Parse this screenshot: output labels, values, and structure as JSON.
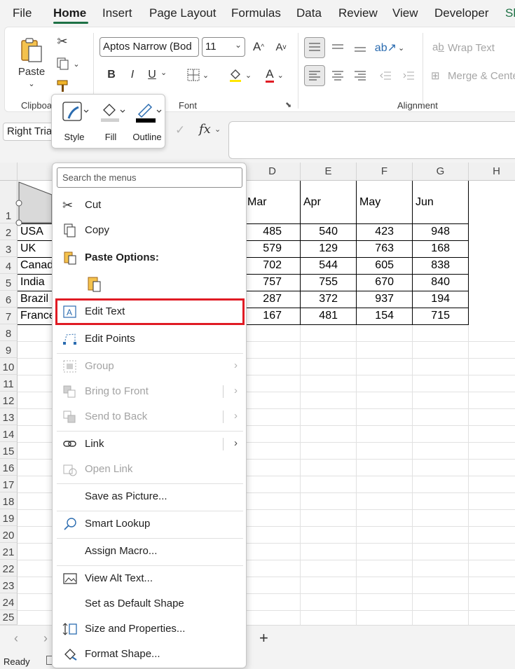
{
  "tabs": [
    "File",
    "Home",
    "Insert",
    "Page Layout",
    "Formulas",
    "Data",
    "Review",
    "View",
    "Developer",
    "Sh"
  ],
  "ribbon": {
    "paste_label": "Paste",
    "clipboard_group": "Clipboa",
    "font_name": "Aptos Narrow (Bod",
    "font_size": "11",
    "font_group": "Font",
    "alignment_group": "Alignment",
    "wrap_text": "Wrap Text",
    "merge_center": "Merge & Cente",
    "bold": "B",
    "italic": "I",
    "underline": "U",
    "font_color_letter": "A",
    "grow_font": "A",
    "shrink_font": "A"
  },
  "formula_bar": {
    "name_box": "Right Tria",
    "fx": "fx"
  },
  "mini_toolbar": {
    "style": "Style",
    "fill": "Fill",
    "outline": "Outline"
  },
  "columns": [
    "D",
    "E",
    "F",
    "G",
    "H"
  ],
  "rows": [
    "1",
    "2",
    "3",
    "4",
    "5",
    "6",
    "7",
    "8",
    "9",
    "10",
    "11",
    "12",
    "13",
    "14",
    "15",
    "16",
    "17",
    "18",
    "19",
    "20",
    "21",
    "22",
    "23",
    "24",
    "25"
  ],
  "sheet": {
    "months": [
      "Mar",
      "Apr",
      "May",
      "Jun"
    ],
    "countries": [
      "USA",
      "UK",
      "Canad",
      "India",
      "Brazil",
      "France"
    ],
    "values": [
      [
        485,
        540,
        423,
        948
      ],
      [
        579,
        129,
        763,
        168
      ],
      [
        702,
        544,
        605,
        838
      ],
      [
        757,
        755,
        670,
        840
      ],
      [
        287,
        372,
        937,
        194
      ],
      [
        167,
        481,
        154,
        715
      ]
    ]
  },
  "context_menu": {
    "search_placeholder": "Search the menus",
    "items": [
      {
        "label": "Cut",
        "icon": "scissors-icon",
        "enabled": true
      },
      {
        "label": "Copy",
        "icon": "copy-icon",
        "enabled": true
      },
      {
        "label": "Paste Options:",
        "icon": "paste-icon",
        "enabled": true
      },
      {
        "label": "Edit Text",
        "icon": "edit-text-icon",
        "enabled": true
      },
      {
        "label": "Edit Points",
        "icon": "edit-points-icon",
        "enabled": true
      },
      {
        "label": "Group",
        "icon": "group-icon",
        "enabled": false
      },
      {
        "label": "Bring to Front",
        "icon": "bring-front-icon",
        "enabled": false
      },
      {
        "label": "Send to Back",
        "icon": "send-back-icon",
        "enabled": false
      },
      {
        "label": "Link",
        "icon": "link-icon",
        "enabled": true
      },
      {
        "label": "Open Link",
        "icon": "open-link-icon",
        "enabled": false
      },
      {
        "label": "Save as Picture...",
        "icon": "",
        "enabled": true
      },
      {
        "label": "Smart Lookup",
        "icon": "smart-lookup-icon",
        "enabled": true
      },
      {
        "label": "Assign Macro...",
        "icon": "",
        "enabled": true
      },
      {
        "label": "View Alt Text...",
        "icon": "alt-text-icon",
        "enabled": true
      },
      {
        "label": "Set as Default Shape",
        "icon": "",
        "enabled": true
      },
      {
        "label": "Size and Properties...",
        "icon": "size-properties-icon",
        "enabled": true
      },
      {
        "label": "Format Shape...",
        "icon": "format-shape-icon",
        "enabled": true
      }
    ]
  },
  "status": {
    "ready": "Ready",
    "add_sheet": "+"
  },
  "colors": {
    "highlight": "#e01b24",
    "accent": "#1e7145"
  }
}
